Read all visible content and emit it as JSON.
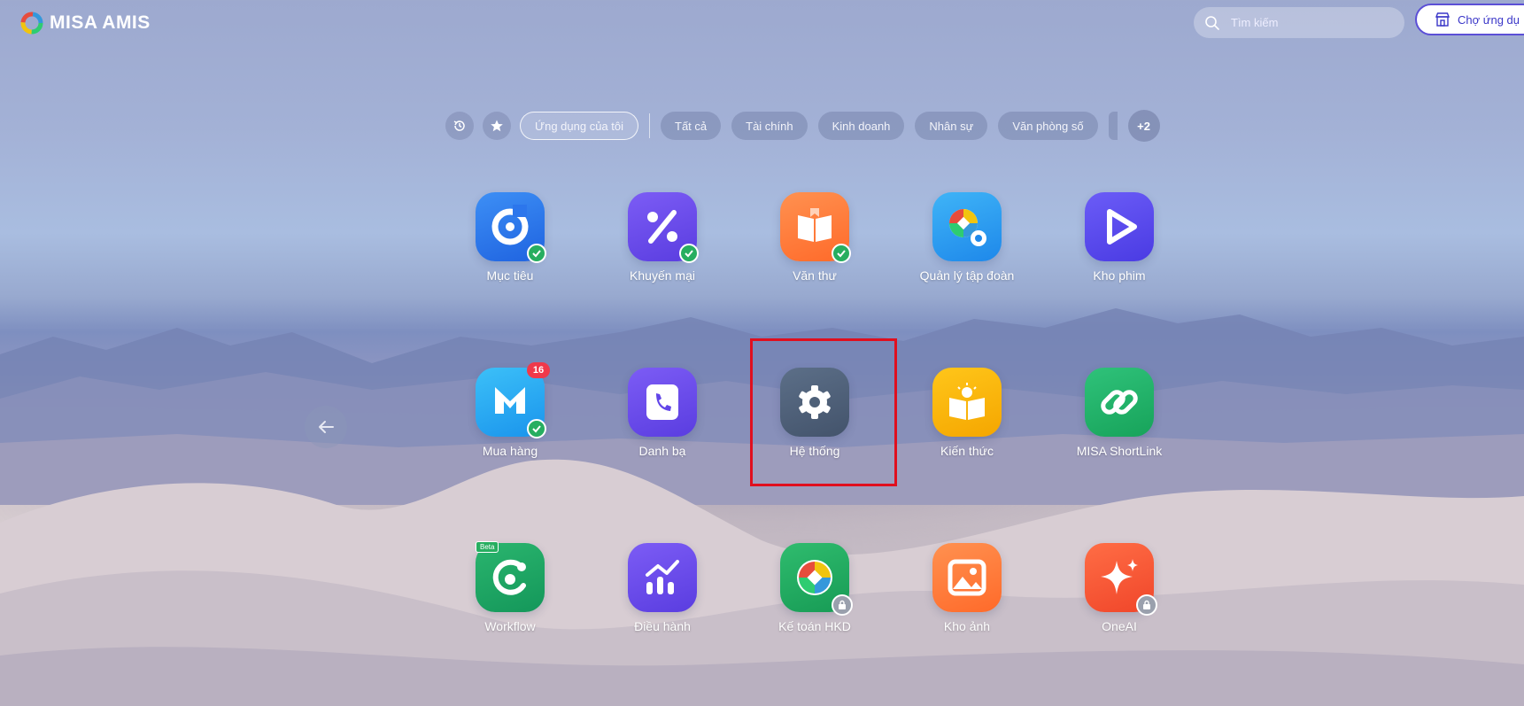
{
  "brand": {
    "name": "MISA AMIS",
    "logo_icon": "misa-ring-logo"
  },
  "search": {
    "placeholder": "Tìm kiếm",
    "icon": "search-icon"
  },
  "market_button": {
    "label": "Chợ ứng dụ",
    "icon": "store-icon"
  },
  "filters": {
    "history_icon": "history-icon",
    "favorite_icon": "star-icon",
    "active": "Ứng dụng của tôi",
    "categories": [
      "Tất cả",
      "Tài chính",
      "Kinh doanh",
      "Nhân sự",
      "Văn phòng số"
    ],
    "more": "+2"
  },
  "apps": [
    {
      "label": "Mục tiêu",
      "icon": "target-icon",
      "color": "#2f7bf0",
      "status": "installed"
    },
    {
      "label": "Khuyến mại",
      "icon": "percent-icon",
      "color": "#6a4cf0",
      "status": "installed"
    },
    {
      "label": "Văn thư",
      "icon": "book-icon",
      "color": "#ff7a3a",
      "status": "installed"
    },
    {
      "label": "Quản lý tập đoàn",
      "icon": "group-management-icon",
      "color": "#2a9df4",
      "status": "none"
    },
    {
      "label": "Kho phim",
      "icon": "play-icon",
      "color": "#5a4af2",
      "status": "none"
    },
    {
      "label": "Mua hàng",
      "icon": "purchase-icon",
      "color": "#27a7f2",
      "status": "installed",
      "badge": "16"
    },
    {
      "label": "Danh bạ",
      "icon": "phone-book-icon",
      "color": "#6a4cf0",
      "status": "none"
    },
    {
      "label": "Hệ thống",
      "icon": "gear-icon",
      "color": "#4e6078",
      "status": "none"
    },
    {
      "label": "Kiến thức",
      "icon": "knowledge-book-icon",
      "color": "#f5b400",
      "status": "none"
    },
    {
      "label": "MISA ShortLink",
      "icon": "link-icon",
      "color": "#22b36a",
      "status": "none"
    },
    {
      "label": "Workflow",
      "icon": "workflow-icon",
      "color": "#1fa664",
      "status": "none",
      "tag": "Beta"
    },
    {
      "label": "Điều hành",
      "icon": "chart-icon",
      "color": "#6a4cf0",
      "status": "none"
    },
    {
      "label": "Kế toán HKD",
      "icon": "accounting-icon",
      "color": "#22a85e",
      "status": "locked"
    },
    {
      "label": "Kho ảnh",
      "icon": "image-icon",
      "color": "#ff7a3a",
      "status": "none"
    },
    {
      "label": "OneAI",
      "icon": "sparkle-icon",
      "color": "#ff5a3a",
      "status": "locked"
    }
  ],
  "prev_page_icon": "arrow-left-icon",
  "highlight_color": "#e00f1e"
}
